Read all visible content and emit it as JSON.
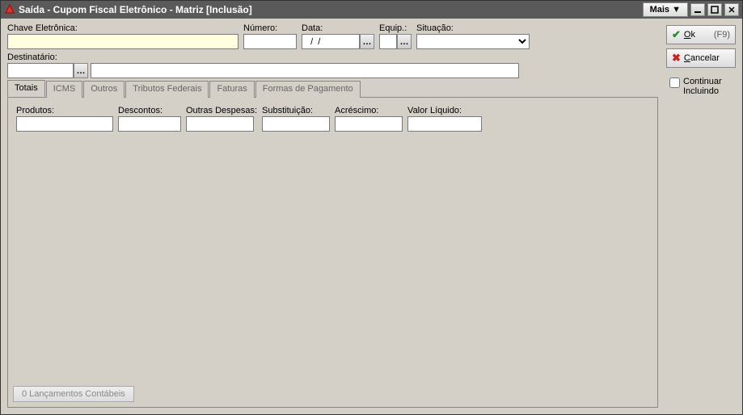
{
  "titlebar": {
    "title": "Saída - Cupom Fiscal Eletrônico - Matriz [Inclusão]",
    "mais_label": "Mais ▼"
  },
  "fields": {
    "chave_label": "Chave Eletrônica:",
    "chave_value": "",
    "numero_label": "Número:",
    "numero_value": "",
    "data_label": "Data:",
    "data_value": "  /  /",
    "equip_label": "Equip.:",
    "equip_value": "",
    "situacao_label": "Situação:",
    "situacao_value": "",
    "destinatario_label": "Destinatário:",
    "destinatario_code": "",
    "destinatario_name": ""
  },
  "tabs": {
    "totais": "Totais",
    "icms": "ICMS",
    "outros": "Outros",
    "tributos": "Tributos Federais",
    "faturas": "Faturas",
    "formas": "Formas de Pagamento"
  },
  "totais": {
    "produtos_label": "Produtos:",
    "produtos_value": "",
    "descontos_label": "Descontos:",
    "descontos_value": "",
    "outras_label": "Outras Despesas:",
    "outras_value": "",
    "subst_label": "Substituição:",
    "subst_value": "",
    "acrescimo_label": "Acréscimo:",
    "acrescimo_value": "",
    "liquido_label": "Valor Líquido:",
    "liquido_value": ""
  },
  "footer": {
    "lancamentos_label": "0 Lançamentos Contábeis"
  },
  "actions": {
    "ok_label": "Ok",
    "ok_shortcut": "(F9)",
    "cancelar_label": "Cancelar",
    "continuar_label": "Continuar Incluindo"
  }
}
